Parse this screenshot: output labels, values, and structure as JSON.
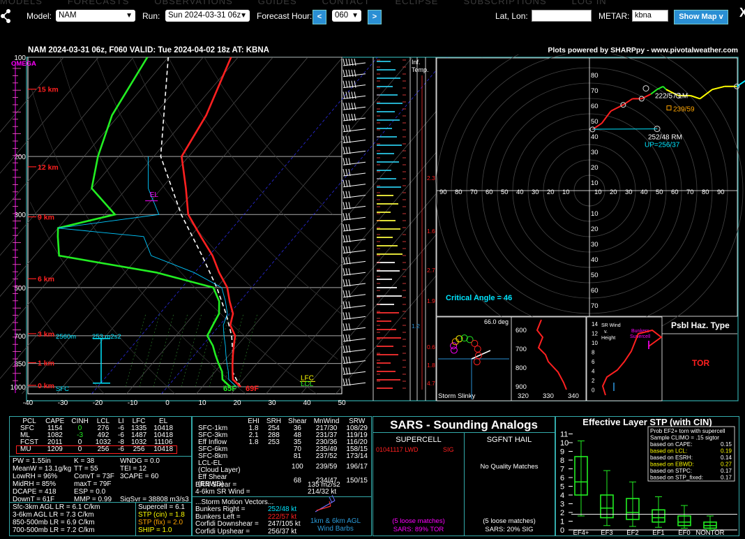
{
  "nav": {
    "ghost_items": [
      "MODELS",
      "FORECASTS",
      "OBSERVATIONS",
      "GUIDES",
      "CONTACT",
      "ECLIPSE",
      "SUBSCRIPTIONS",
      "LOG IN"
    ],
    "model_label": "Model:",
    "model_value": "NAM",
    "run_label": "Run:",
    "run_value": "Sun 2024-03-31 06z",
    "fh_label": "Forecast Hour:",
    "fh_value": "060",
    "prev": "<",
    "next": ">",
    "latlon_label": "Lat, Lon:",
    "latlon_value": "",
    "metar_label": "METAR:",
    "metar_value": "kbna",
    "show_map": "Show Map v",
    "close": "X",
    "corner_text": "nivotal.ccm"
  },
  "header": {
    "title": "NAM 2024-03-31 06z, F060   VALID: Tue 2024-04-02 18z   AT: KBNA",
    "credit": "Plots powered by SHARPpy - www.pivotalweather.com"
  },
  "chart_data": [
    {
      "type": "line",
      "name": "skew-t",
      "x_ticks": [
        "-40",
        "-30",
        "-20",
        "-10",
        "0",
        "10",
        "20",
        "30",
        "40",
        "50"
      ],
      "p_ticks": [
        "100",
        "200",
        "300",
        "500",
        "700",
        "850",
        "1000"
      ],
      "height_labels": [
        "15 km",
        "12 km",
        "9 km",
        "6 km",
        "3 km",
        "1 km",
        "0 km"
      ],
      "omega_label": "OMEGA",
      "el_label": "EL",
      "lfc_label": "LFC",
      "lcl_label": "LCL",
      "sfc_label": "SFC",
      "sfc_td_label": "65F",
      "sfc_t_label": "69F",
      "layer_label_m": "2560m",
      "layer_label_srh": "253 m2s2",
      "temperature": [
        [
          100,
          -62
        ],
        [
          150,
          -55
        ],
        [
          200,
          -52
        ],
        [
          250,
          -43
        ],
        [
          300,
          -36
        ],
        [
          350,
          -27
        ],
        [
          400,
          -19
        ],
        [
          450,
          -13
        ],
        [
          500,
          -7
        ],
        [
          550,
          -3
        ],
        [
          600,
          1
        ],
        [
          650,
          3
        ],
        [
          700,
          7
        ],
        [
          750,
          9
        ],
        [
          800,
          11
        ],
        [
          850,
          13
        ],
        [
          900,
          15
        ],
        [
          950,
          17
        ],
        [
          1000,
          21
        ]
      ],
      "dewpoint": [
        [
          100,
          -86
        ],
        [
          150,
          -82
        ],
        [
          200,
          -76
        ],
        [
          250,
          -70
        ],
        [
          300,
          -57
        ],
        [
          330,
          -70
        ],
        [
          350,
          -68
        ],
        [
          400,
          -63
        ],
        [
          450,
          -31
        ],
        [
          500,
          -11
        ],
        [
          550,
          -6
        ],
        [
          600,
          -3
        ],
        [
          650,
          -2
        ],
        [
          700,
          -1
        ],
        [
          750,
          3
        ],
        [
          800,
          6
        ],
        [
          850,
          9
        ],
        [
          900,
          12
        ],
        [
          950,
          14
        ],
        [
          1000,
          18
        ]
      ],
      "parcel": [
        [
          1000,
          21
        ],
        [
          950,
          18
        ],
        [
          900,
          15
        ],
        [
          850,
          13
        ],
        [
          800,
          11
        ],
        [
          700,
          6
        ],
        [
          600,
          -1
        ],
        [
          500,
          -10
        ],
        [
          400,
          -22
        ],
        [
          300,
          -38
        ],
        [
          200,
          -58
        ],
        [
          100,
          -80
        ]
      ]
    },
    {
      "type": "line",
      "name": "hodograph",
      "rings": [
        "10",
        "20",
        "30",
        "40",
        "50",
        "60",
        "70",
        "80"
      ],
      "axis_labels": [
        "90",
        "80",
        "70",
        "60",
        "50",
        "40",
        "30",
        "20",
        "10"
      ],
      "lm_label": "222/57 LM",
      "rm_label": "252/48 RM",
      "up_label": "UP=256/37",
      "dn_label": "239/59",
      "critical_angle": "Critical Angle = 46",
      "points_uv": [
        [
          2,
          -8
        ],
        [
          8,
          -12
        ],
        [
          14,
          -20
        ],
        [
          22,
          -24
        ],
        [
          28,
          -28
        ],
        [
          34,
          -28
        ],
        [
          40,
          -31
        ],
        [
          44,
          -34
        ],
        [
          48,
          -36
        ],
        [
          50,
          -34
        ],
        [
          58,
          -30
        ],
        [
          66,
          -30
        ],
        [
          72,
          -28
        ],
        [
          80,
          -34
        ],
        [
          88,
          -36
        ],
        [
          96,
          -36
        ],
        [
          102,
          -40
        ]
      ],
      "lm_uv": [
        30,
        -42
      ],
      "rm_uv": [
        45,
        -12
      ],
      "up_uv": [
        45,
        -10
      ]
    },
    {
      "type": "scatter",
      "name": "storm-slinky",
      "label": "Storm Slinky",
      "angle_label": "66.0 deg",
      "y_ticks": [
        "600",
        "700",
        "800",
        "900"
      ],
      "x_ticks": [
        "320",
        "330",
        "340"
      ],
      "right_ticks": [
        "14",
        "12",
        "10",
        "8",
        "6",
        "4",
        "2",
        "0"
      ],
      "sr_label": "SR Wind v. Height",
      "supercell_label": "Bunkers Supercell"
    },
    {
      "type": "bar",
      "name": "stp",
      "title": "Effective Layer STP (with CIN)",
      "categories": [
        "EF4+",
        "EF3",
        "EF2",
        "EF1",
        "EF0",
        "NONTOR"
      ],
      "y_ticks": [
        "0",
        "1",
        "2",
        "3",
        "4",
        "5",
        "6",
        "7",
        "8",
        "9",
        "10",
        "11"
      ],
      "boxes": [
        [
          1.6,
          4,
          5.5,
          8.4,
          10.2
        ],
        [
          0.5,
          1.4,
          2.5,
          4,
          6.8
        ],
        [
          0.4,
          1.2,
          2,
          3.6,
          5.5
        ],
        [
          0.3,
          0.9,
          1.4,
          2.3,
          3.8
        ],
        [
          0.2,
          0.5,
          0.9,
          1.6,
          2.8
        ],
        [
          0,
          0.2,
          0.5,
          0.9,
          1.6
        ]
      ],
      "value": 0.99
    }
  ],
  "sidebar_labels": {
    "inf_temp": "Inf. Temp.",
    "tick_values": [
      "2.3",
      "1.6",
      "2.7",
      "1.9",
      "0.6",
      "1.8",
      "4.7",
      "1.2"
    ]
  },
  "params": {
    "header": [
      "PCL",
      "CAPE",
      "CINH",
      "LCL",
      "LI",
      "LFC",
      "EL"
    ],
    "rows": [
      [
        "SFC",
        "1154",
        "0",
        "276",
        "-6",
        "1335",
        "10418"
      ],
      [
        "ML",
        "1082",
        "-3",
        "492",
        "-6",
        "1487",
        "10418"
      ],
      [
        "FCST",
        "2011",
        "0",
        "1032",
        "-8",
        "1032",
        "11106"
      ],
      [
        "MU",
        "1209",
        "0",
        "256",
        "-6",
        "256",
        "10418"
      ]
    ],
    "indices": [
      "PW = 1.55in",
      "MeanW = 13.1g/kg",
      "LowRH = 96%",
      "MidRH = 85%",
      "DCAPE = 418",
      "DownT = 61F"
    ],
    "indices2": [
      "K = 38",
      "TT = 55",
      "ConvT = 73F",
      "maxT = 79F",
      "ESP = 0.0",
      "MMP = 0.99"
    ],
    "indices3": [
      "WNDG = 0.0",
      "TEI = 12",
      "3CAPE = 60",
      "",
      "",
      "SigSvr = 38808 m3/s3"
    ],
    "lapse": [
      "Sfc-3km AGL LR = 6.1 C/km",
      "3-6km AGL LR = 7.3 C/km",
      "850-500mb LR = 6.9 C/km",
      "700-500mb LR = 7.2 C/km"
    ],
    "comp": [
      "Supercell = 6.1",
      "STP (cin) = 1.8",
      "STP (fix) = 2.0",
      "SHIP = 1.0"
    ]
  },
  "kin": {
    "header": [
      "",
      "EHI",
      "SRH",
      "Shear",
      "MnWind",
      "SRW"
    ],
    "rows": [
      [
        "SFC-1km",
        "1.8",
        "254",
        "36",
        "217/30",
        "108/29"
      ],
      [
        "SFC-3km",
        "2.1",
        "288",
        "48",
        "231/37",
        "119/19"
      ],
      [
        "Eff Inflow",
        "1.8",
        "253",
        "35",
        "230/36",
        "116/20"
      ],
      [
        "",
        "",
        "",
        "",
        "",
        ""
      ],
      [
        "SFC-6km",
        "",
        "",
        "70",
        "235/49",
        "158/15"
      ],
      [
        "SFC-8km",
        "",
        "",
        "81",
        "237/52",
        "173/14"
      ],
      [
        "LCL-EL (Cloud Layer)",
        "",
        "",
        "100",
        "239/59",
        "196/17"
      ],
      [
        "Eff Shear (EBWD)",
        "",
        "",
        "68",
        "234/47",
        "150/15"
      ]
    ],
    "brn": "BRN Shear =",
    "brn_v": "135 m2/s2",
    "srw": "4-6km SR Wind =",
    "srw_v": "214/32 kt",
    "sm_title": "...Storm Motion Vectors...",
    "sm": [
      [
        "Bunkers Right =",
        "252/48 kt"
      ],
      [
        "Bunkers Left =",
        "222/57 kt"
      ],
      [
        "Corfidi Downshear =",
        "247/105 kt"
      ],
      [
        "Corfidi Upshear =",
        "256/37 kt"
      ]
    ],
    "barbs_label": "1km & 6km AGL Wind Barbs"
  },
  "sars": {
    "title": "SARS - Sounding Analogs",
    "supercell": "SUPERCELL",
    "hail": "SGFNT HAIL",
    "match": "01041117 LWD",
    "match_tag": "SIG",
    "no_quality": "No Quality Matches",
    "loose1": "(5 loose matches)",
    "sars1": "SARS: 89% TOR",
    "loose2": "(5 loose matches)",
    "sars2": "SARS: 20% SIG"
  },
  "psbl": {
    "title": "Psbl Haz. Type",
    "value": "TOR"
  },
  "stp_box": {
    "lines": [
      [
        "Prob EF2+ torn with supercell",
        ""
      ],
      [
        "Sample CLIMO = .15 sigtor",
        ""
      ],
      [
        "based on CAPE:",
        "0.15"
      ],
      [
        "based on LCL:",
        "0.19"
      ],
      [
        "based on ESRH:",
        "0.14"
      ],
      [
        "based on EBWD:",
        "0.27"
      ],
      [
        "based on STPC:",
        "0.17"
      ],
      [
        "based on STP_fixed:",
        "0.17"
      ]
    ]
  },
  "colors": {
    "temp": "#ff2020",
    "dew": "#22ee22",
    "accent": "#2a8fd4",
    "yellow": "#ffff00",
    "magenta": "#ff00ff",
    "cyan": "#00e5ff"
  }
}
